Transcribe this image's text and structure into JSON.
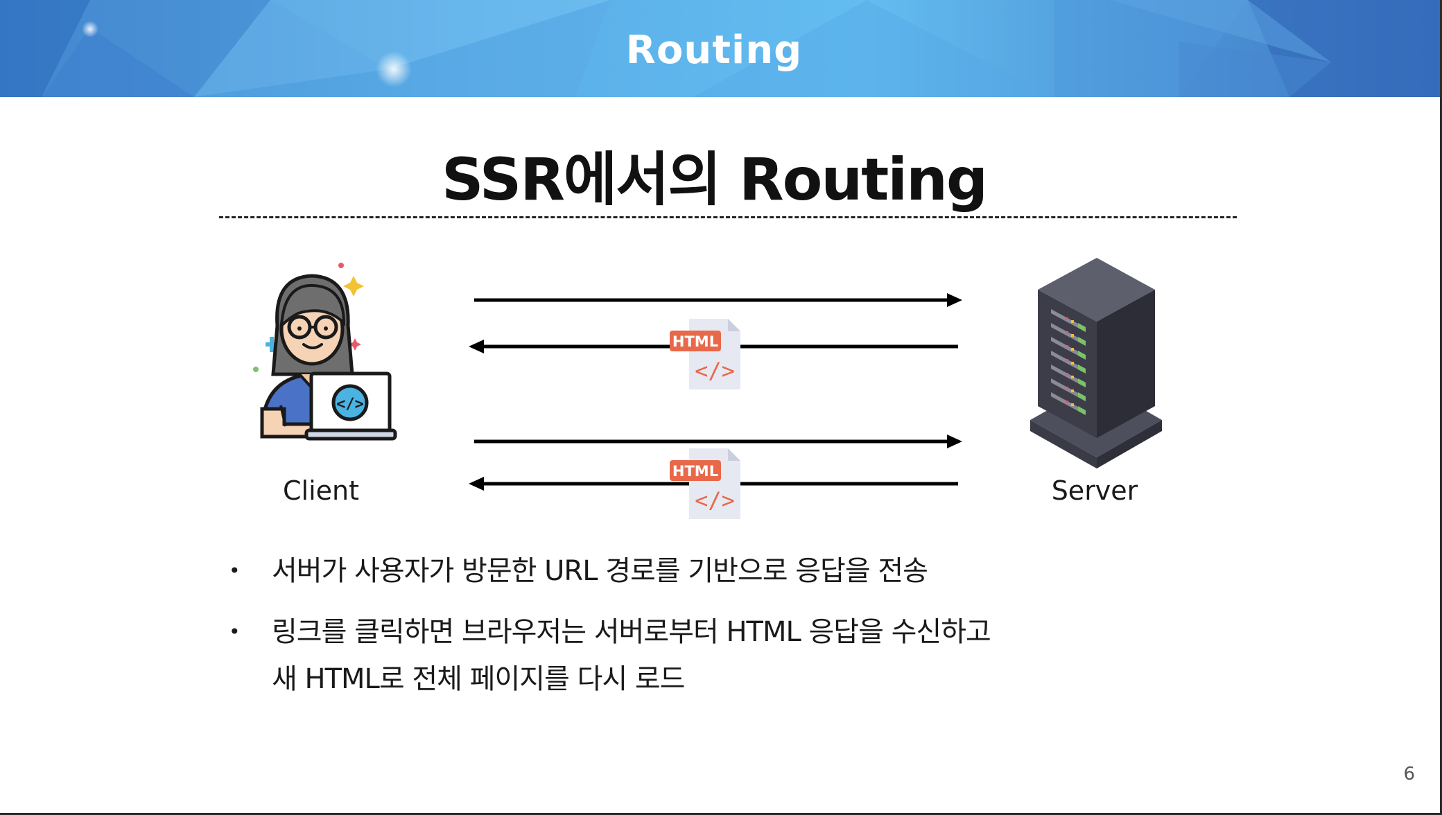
{
  "header": {
    "banner_title": "Routing"
  },
  "slide": {
    "title": "SSR에서의 Routing",
    "page_number": "6"
  },
  "diagram": {
    "client_label": "Client",
    "server_label": "Server",
    "document_badge": "HTML",
    "document_symbol": "</>",
    "icons": [
      "developer-with-laptop-icon",
      "server-rack-icon",
      "html-document-icon"
    ],
    "colors": {
      "badge": "#e8684a",
      "document": "#e6e9f2",
      "arrow": "#000000"
    }
  },
  "bullets": [
    {
      "lines": [
        "서버가 사용자가 방문한 URL 경로를 기반으로 응답을 전송"
      ]
    },
    {
      "lines": [
        "링크를 클릭하면 브라우저는 서버로부터 HTML 응답을 수신하고",
        "새 HTML로 전체 페이지를 다시 로드"
      ]
    }
  ]
}
